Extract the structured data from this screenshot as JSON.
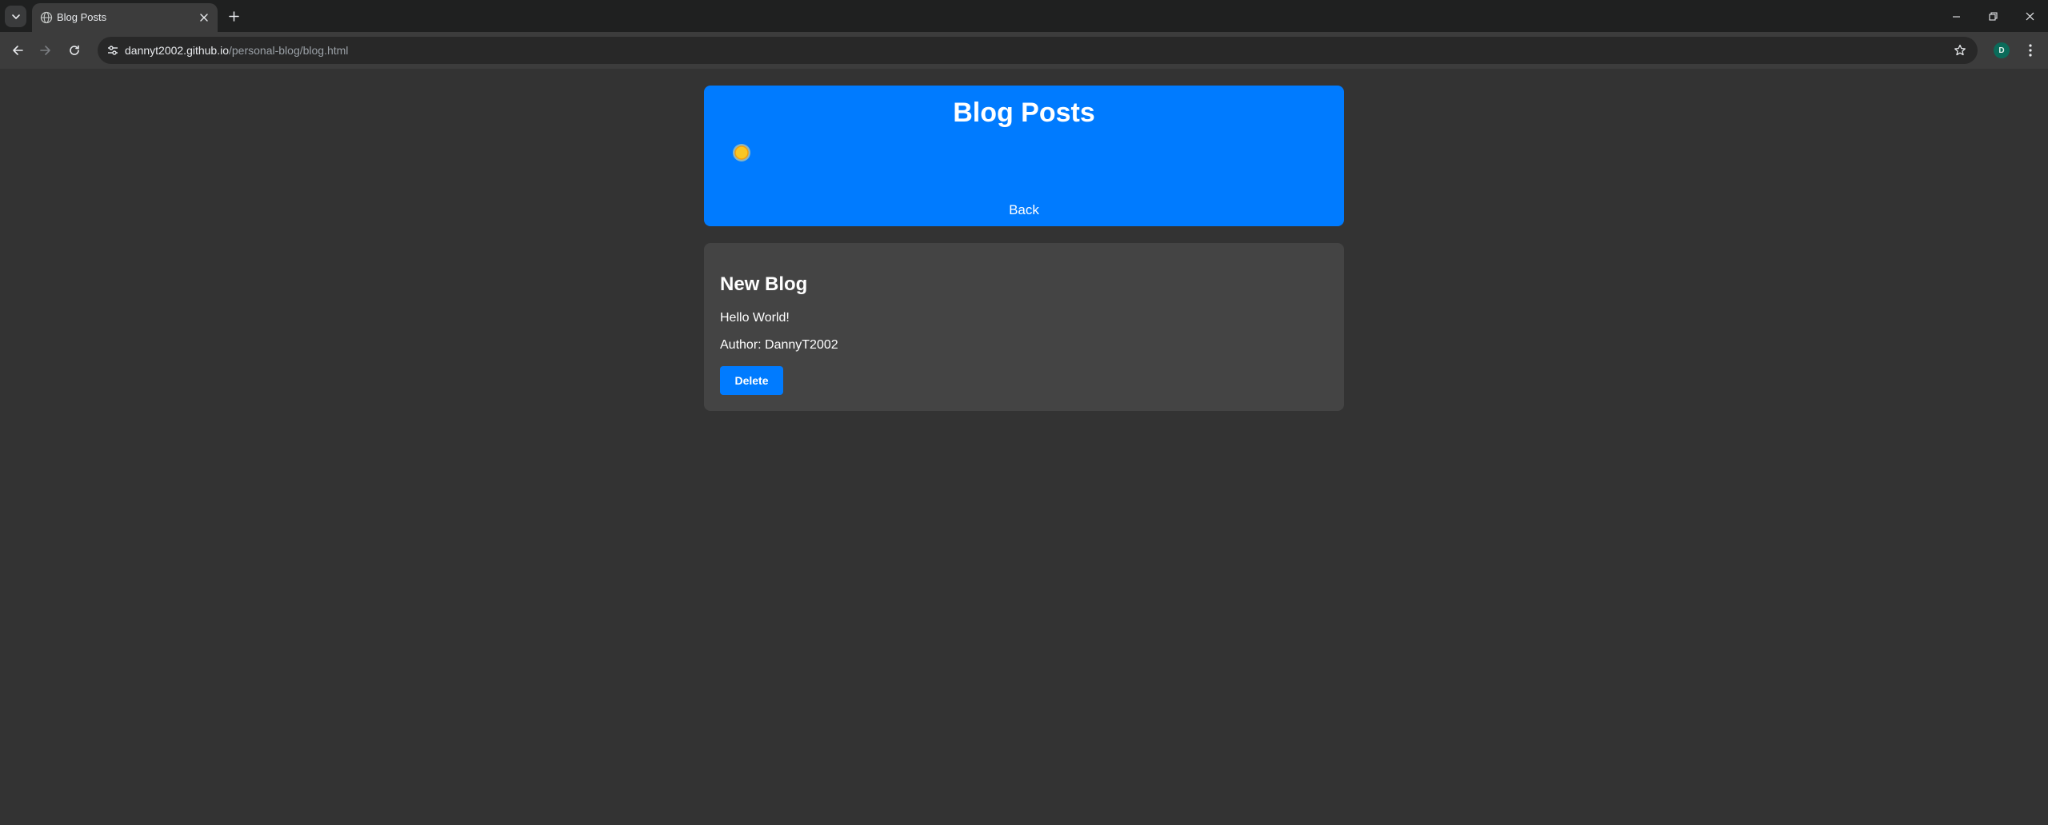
{
  "browser": {
    "tab": {
      "title": "Blog Posts"
    },
    "address_bar": {
      "host": "dannyt2002.github.io",
      "path": "/personal-blog/blog.html"
    },
    "profile_initial": "D",
    "icons": {
      "tab_search": "chevron-down-icon",
      "favicon": "globe-icon",
      "tab_close": "close-icon",
      "new_tab": "plus-icon",
      "back": "arrow-left-icon",
      "forward": "arrow-right-icon",
      "reload": "reload-icon",
      "site_info": "tune-icon",
      "bookmark": "star-icon",
      "menu": "kebab-menu-icon",
      "minimize": "minimize-icon",
      "restore": "restore-icon",
      "close_window": "close-icon"
    }
  },
  "page": {
    "header": {
      "title": "Blog Posts",
      "theme_toggle_icon": "sun-icon",
      "back_label": "Back"
    },
    "posts": [
      {
        "title": "New Blog",
        "content": "Hello World!",
        "author": "Author: DannyT2002",
        "delete_label": "Delete"
      }
    ]
  },
  "colors": {
    "page_background": "#333333",
    "accent": "#007bff",
    "card_background": "#444444",
    "sun": "#f9c623"
  }
}
